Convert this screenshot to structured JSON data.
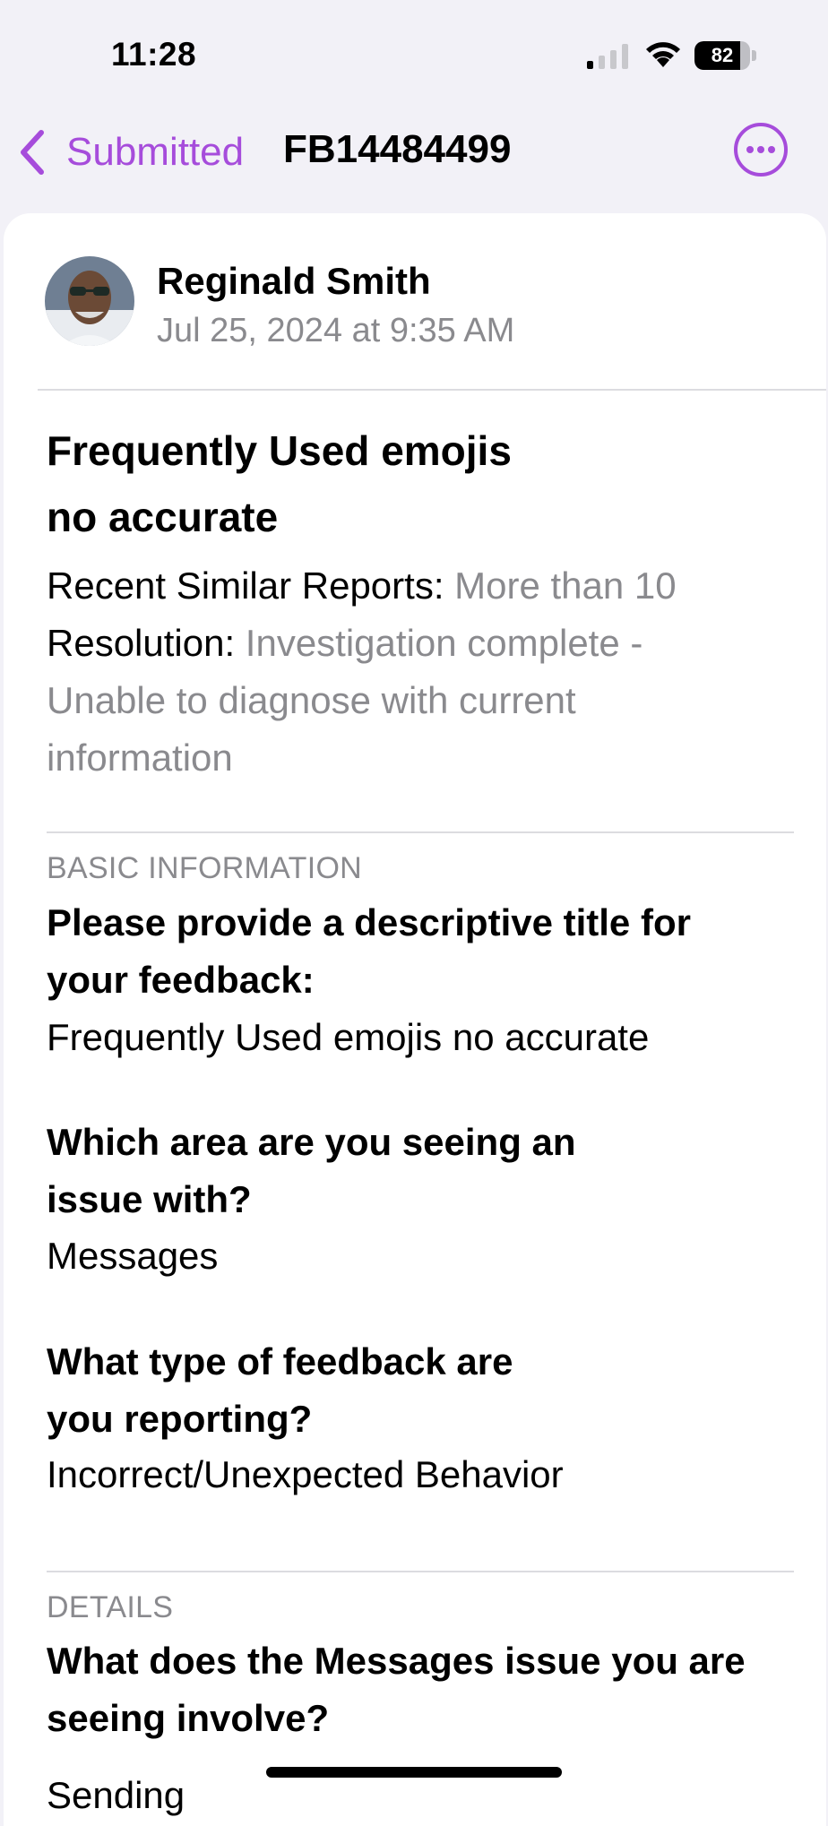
{
  "status_bar": {
    "time": "11:28",
    "battery": "82",
    "battery_level": 0.82
  },
  "nav": {
    "back_label": "Submitted",
    "title": "FB14484499"
  },
  "author": {
    "name": "Reginald Smith",
    "date": "Jul 25, 2024 at 9:35 AM"
  },
  "report": {
    "title_line1": "Frequently Used emojis",
    "title_line2": "no accurate",
    "similar_label": "Recent Similar Reports:",
    "similar_value": "More than 10",
    "resolution_label": "Resolution:",
    "resolution_value": "Investigation complete - Unable to diagnose with current information"
  },
  "basic": {
    "header": "BASIC INFORMATION",
    "q1": "Please provide a descriptive title for your feedback:",
    "a1": "Frequently Used emojis no accurate",
    "q2_line1": "Which area are you seeing an",
    "q2_line2": "issue with?",
    "a2": "Messages",
    "q3_line1": "What type of feedback are",
    "q3_line2": "you reporting?",
    "a3": "Incorrect/Unexpected Behavior"
  },
  "details": {
    "header": "DETAILS",
    "q1": "What does the Messages issue you are seeing involve?",
    "a1_partial": "Sending"
  },
  "colors": {
    "accent": "#a64cdb",
    "secondary_text": "#8a8a8e",
    "background": "#f2f1f7"
  },
  "icons": [
    "chevron-left-icon",
    "ellipsis-circle-icon",
    "cellular-signal-icon",
    "wifi-icon",
    "battery-icon"
  ]
}
